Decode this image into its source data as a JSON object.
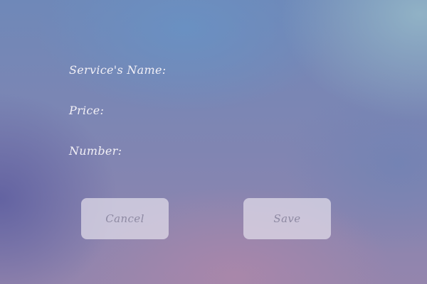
{
  "form": {
    "service_name_label": "Service's Name:",
    "price_label": "Price:",
    "number_label": "Number:"
  },
  "actions": {
    "cancel_label": "Cancel",
    "save_label": "Save"
  }
}
